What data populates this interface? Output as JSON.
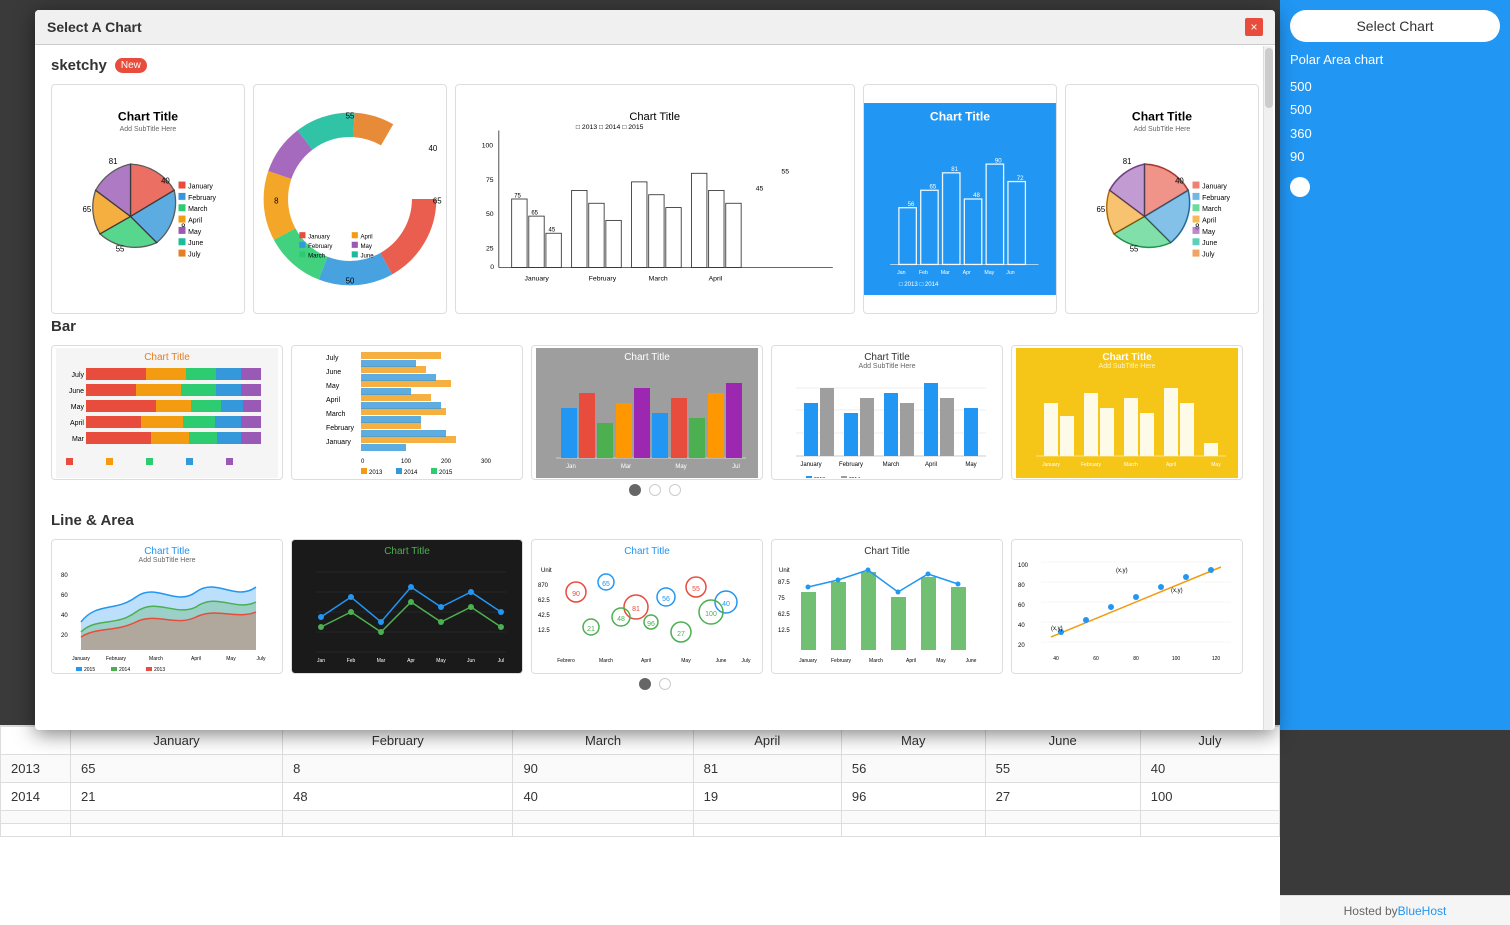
{
  "modal": {
    "title": "Select A Chart",
    "close_label": "×"
  },
  "sections": {
    "sketchy": {
      "label": "sketchy",
      "badge": "New",
      "charts": [
        {
          "id": "sketchy-pie",
          "type": "Sketchy Pie"
        },
        {
          "id": "sketchy-donut",
          "type": "Sketchy Donut"
        },
        {
          "id": "sketchy-bar-group",
          "type": "Sketchy Grouped Bar"
        },
        {
          "id": "sketchy-bar-blue",
          "type": "Sketchy Bar Blue"
        },
        {
          "id": "sketchy-pie2",
          "type": "Sketchy Pie 2"
        }
      ]
    },
    "bar": {
      "label": "Bar",
      "charts": [
        {
          "id": "bar-stacked-color",
          "type": "Stacked Bar Colorful"
        },
        {
          "id": "bar-horizontal",
          "type": "Horizontal Bar"
        },
        {
          "id": "bar-grouped-color",
          "type": "Grouped Bar Colorful"
        },
        {
          "id": "bar-grouped-gray",
          "type": "Grouped Bar Gray"
        },
        {
          "id": "bar-grouped-yellow",
          "type": "Grouped Bar Yellow"
        }
      ],
      "pagination": [
        {
          "active": true
        },
        {
          "active": false
        },
        {
          "active": false
        }
      ]
    },
    "line_area": {
      "label": "Line & Area",
      "charts": [
        {
          "id": "area-multi",
          "type": "Multi Area"
        },
        {
          "id": "line-dark",
          "type": "Line Dark"
        },
        {
          "id": "line-bubble",
          "type": "Line Bubble"
        },
        {
          "id": "line-bar-combo",
          "type": "Line Bar Combo"
        },
        {
          "id": "line-scatter",
          "type": "Line Scatter"
        }
      ],
      "pagination": [
        {
          "active": true
        },
        {
          "active": false
        }
      ]
    }
  },
  "right_panel": {
    "select_chart_label": "Select Chart",
    "chart_type_label": "Polar Area chart",
    "values": [
      "500",
      "500",
      "360",
      "90"
    ]
  },
  "spreadsheet": {
    "headers": [
      "",
      "January",
      "February",
      "March",
      "April",
      "May",
      "June",
      "July"
    ],
    "rows": [
      {
        "year": "2013",
        "values": [
          "65",
          "8",
          "90",
          "81",
          "56",
          "55",
          "40"
        ]
      },
      {
        "year": "2014",
        "values": [
          "21",
          "48",
          "40",
          "19",
          "96",
          "27",
          "100"
        ]
      },
      {
        "year": "",
        "values": [
          "",
          "",
          "",
          "",
          "",
          "",
          ""
        ]
      },
      {
        "year": "",
        "values": [
          "",
          "",
          "",
          "",
          "",
          "",
          ""
        ]
      }
    ]
  },
  "hosted_by": {
    "text": "Hosted by ",
    "link_text": "BlueHost"
  }
}
